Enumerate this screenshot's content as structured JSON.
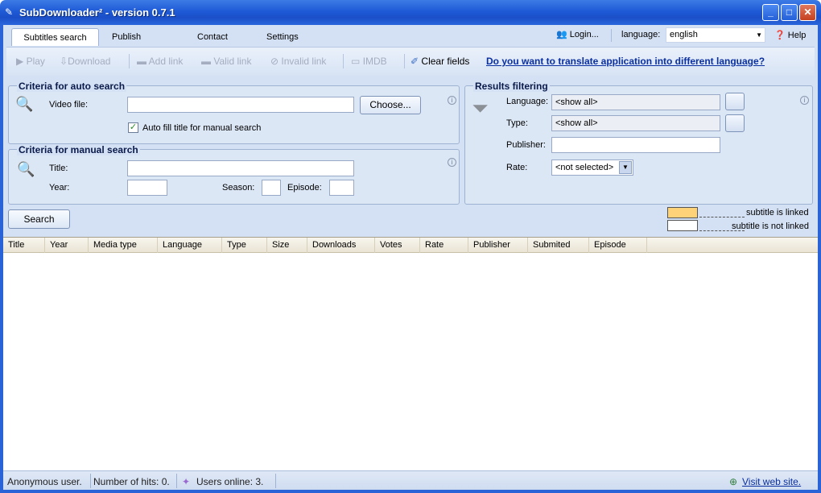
{
  "window": {
    "title": "SubDownloader² - version 0.7.1",
    "minimize": "_",
    "maximize": "□",
    "close": "✕"
  },
  "tabs": [
    "Subtitles search",
    "Publish subtitle",
    "Contact Us",
    "Settings"
  ],
  "header": {
    "login": "Login...",
    "language_label": "language:",
    "language_value": "english",
    "help": "Help"
  },
  "toolbar": {
    "play": "Play",
    "download": "Download",
    "add_link": "Add link",
    "valid_link": "Valid link",
    "invalid_link": "Invalid link",
    "imdb": "IMDB",
    "clear_fields": "Clear fields",
    "translate_link": "Do you want to translate application into different language?"
  },
  "auto_search": {
    "legend": "Criteria for auto search",
    "video_file_label": "Video file:",
    "video_file_value": "",
    "choose_button": "Choose...",
    "autofill_label": "Auto fill title for manual search",
    "autofill_checked": "✓"
  },
  "manual_search": {
    "legend": "Criteria for manual search",
    "title_label": "Title:",
    "year_label": "Year:",
    "season_label": "Season:",
    "episode_label": "Episode:",
    "search_button": "Search"
  },
  "filtering": {
    "legend": "Results filtering",
    "language_label": "Language:",
    "language_value": "<show all>",
    "type_label": "Type:",
    "type_value": "<show all>",
    "publisher_label": "Publisher:",
    "rate_label": "Rate:",
    "rate_value": "<not selected>"
  },
  "legend": {
    "linked": "subtitle is linked",
    "not_linked": "subtitle is not linked",
    "linked_color": "#fdd278",
    "not_linked_color": "#ffffff"
  },
  "columns": [
    "Title",
    "Year",
    "Media type",
    "Language",
    "Type",
    "Size",
    "Downloads",
    "Votes",
    "Rate",
    "Publisher",
    "Submited",
    "Episode"
  ],
  "status": {
    "user": "Anonymous user.",
    "hits": "Number of hits: 0.",
    "online": "Users online: 3.",
    "website": "Visit web site."
  }
}
